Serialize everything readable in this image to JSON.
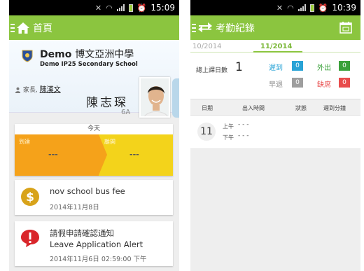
{
  "left": {
    "status": {
      "time": "15:09"
    },
    "appbar": {
      "title": "首頁"
    },
    "school": {
      "name_prefix": "Demo",
      "name_cn": "博文亞洲中學",
      "name_en": "Demo IP25 Secondary School"
    },
    "parent": {
      "role": "家長,",
      "name": "陳漢文"
    },
    "student": {
      "name": "陳志琛",
      "class": "6A"
    },
    "today": {
      "title": "今天",
      "arrive_label": "到達",
      "arrive_value": "---",
      "leave_label": "離開",
      "leave_value": "---"
    },
    "notifications": [
      {
        "icon": "dollar-icon",
        "line1": "nov school bus fee",
        "date": "2014年11月8日"
      },
      {
        "icon": "alert-icon",
        "line1": "請假申請確認通知",
        "line2": "Leave Application Alert",
        "date": "2014年11月6日 02:59:00 下午"
      }
    ]
  },
  "right": {
    "status": {
      "time": "10:39"
    },
    "appbar": {
      "title": "考勤紀錄"
    },
    "months": {
      "prev": "10/2014",
      "current": "11/2014"
    },
    "summary": {
      "total_label": "總上課日數",
      "total_value": "1",
      "late_label": "遲到",
      "late_value": "0",
      "out_label": "外出",
      "out_value": "0",
      "early_label": "早退",
      "early_value": "0",
      "absent_label": "缺席",
      "absent_value": "0"
    },
    "table": {
      "headers": [
        "日期",
        "出入時間",
        "狀態",
        "遲到分鐘"
      ],
      "rows": [
        {
          "day": "11",
          "am_label": "上午",
          "am_value": "- - -",
          "pm_label": "下午",
          "pm_value": "- - -"
        }
      ]
    }
  },
  "colors": {
    "appbar": "#8bc53f",
    "arrive": "#f5a21a",
    "leave": "#f3d31b",
    "late": "#29a3d6",
    "out": "#3aa13a",
    "early": "#9e9e9e",
    "absent": "#e84c4c"
  }
}
